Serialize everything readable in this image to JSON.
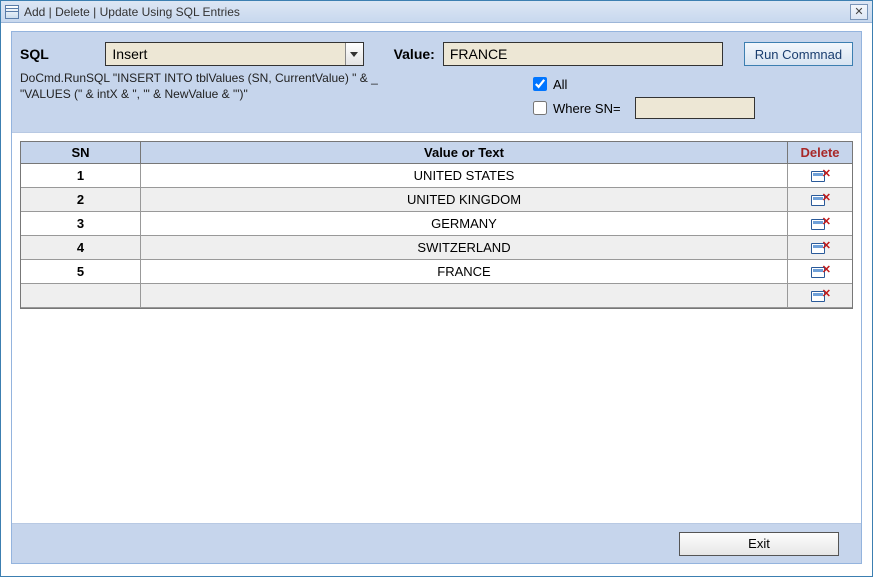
{
  "window_title": "Add | Delete | Update Using SQL Entries",
  "labels": {
    "sql": "SQL",
    "value": "Value:",
    "all": "All",
    "where_sn": "Where SN="
  },
  "sql_combo": {
    "selected": "Insert"
  },
  "value_input": "FRANCE",
  "run_btn": "Run Commnad",
  "code_line1": "DoCmd.RunSQL \"INSERT INTO tblValues (SN, CurrentValue) \" & _",
  "code_line2": "\"VALUES (\" & intX & \", '\" & NewValue & \"')\"",
  "opts": {
    "all_checked": true,
    "where_checked": false,
    "where_value": ""
  },
  "grid": {
    "headers": {
      "sn": "SN",
      "value": "Value or Text",
      "delete": "Delete"
    },
    "rows": [
      {
        "sn": "1",
        "value": "UNITED STATES"
      },
      {
        "sn": "2",
        "value": "UNITED KINGDOM"
      },
      {
        "sn": "3",
        "value": "GERMANY"
      },
      {
        "sn": "4",
        "value": "SWITZERLAND"
      },
      {
        "sn": "5",
        "value": "FRANCE"
      },
      {
        "sn": "",
        "value": ""
      }
    ]
  },
  "exit_btn": "Exit"
}
